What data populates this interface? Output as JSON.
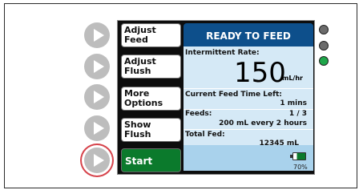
{
  "menu": {
    "adjust_feed": "Adjust\nFeed",
    "adjust_flush": "Adjust\nFlush",
    "more_options": "More\nOptions",
    "show_flush": "Show\nFlush",
    "start": "Start"
  },
  "status": {
    "title": "READY TO FEED"
  },
  "info": {
    "intermittent_rate_label": "Intermittent Rate:",
    "rate_value": "150",
    "rate_unit": "mL/hr",
    "feed_time_label": "Current Feed Time Left:",
    "feed_time_value": "1 mins",
    "feeds_label": "Feeds:",
    "feeds_count": "1 / 3",
    "feeds_detail": "200 mL every 2 hours",
    "total_fed_label": "Total Fed:",
    "total_fed_value": "12345 mL"
  },
  "battery": {
    "percent": "70%",
    "level_fraction": 0.7
  },
  "leds": [
    "gray",
    "gray",
    "green"
  ],
  "colors": {
    "header_blue": "#0d4f8b",
    "panel_blue": "#d5e9f6",
    "start_green": "#0b7a2c",
    "led_green": "#1fa64a",
    "led_gray": "#6b6b6b",
    "active_ring": "#d6434b"
  }
}
